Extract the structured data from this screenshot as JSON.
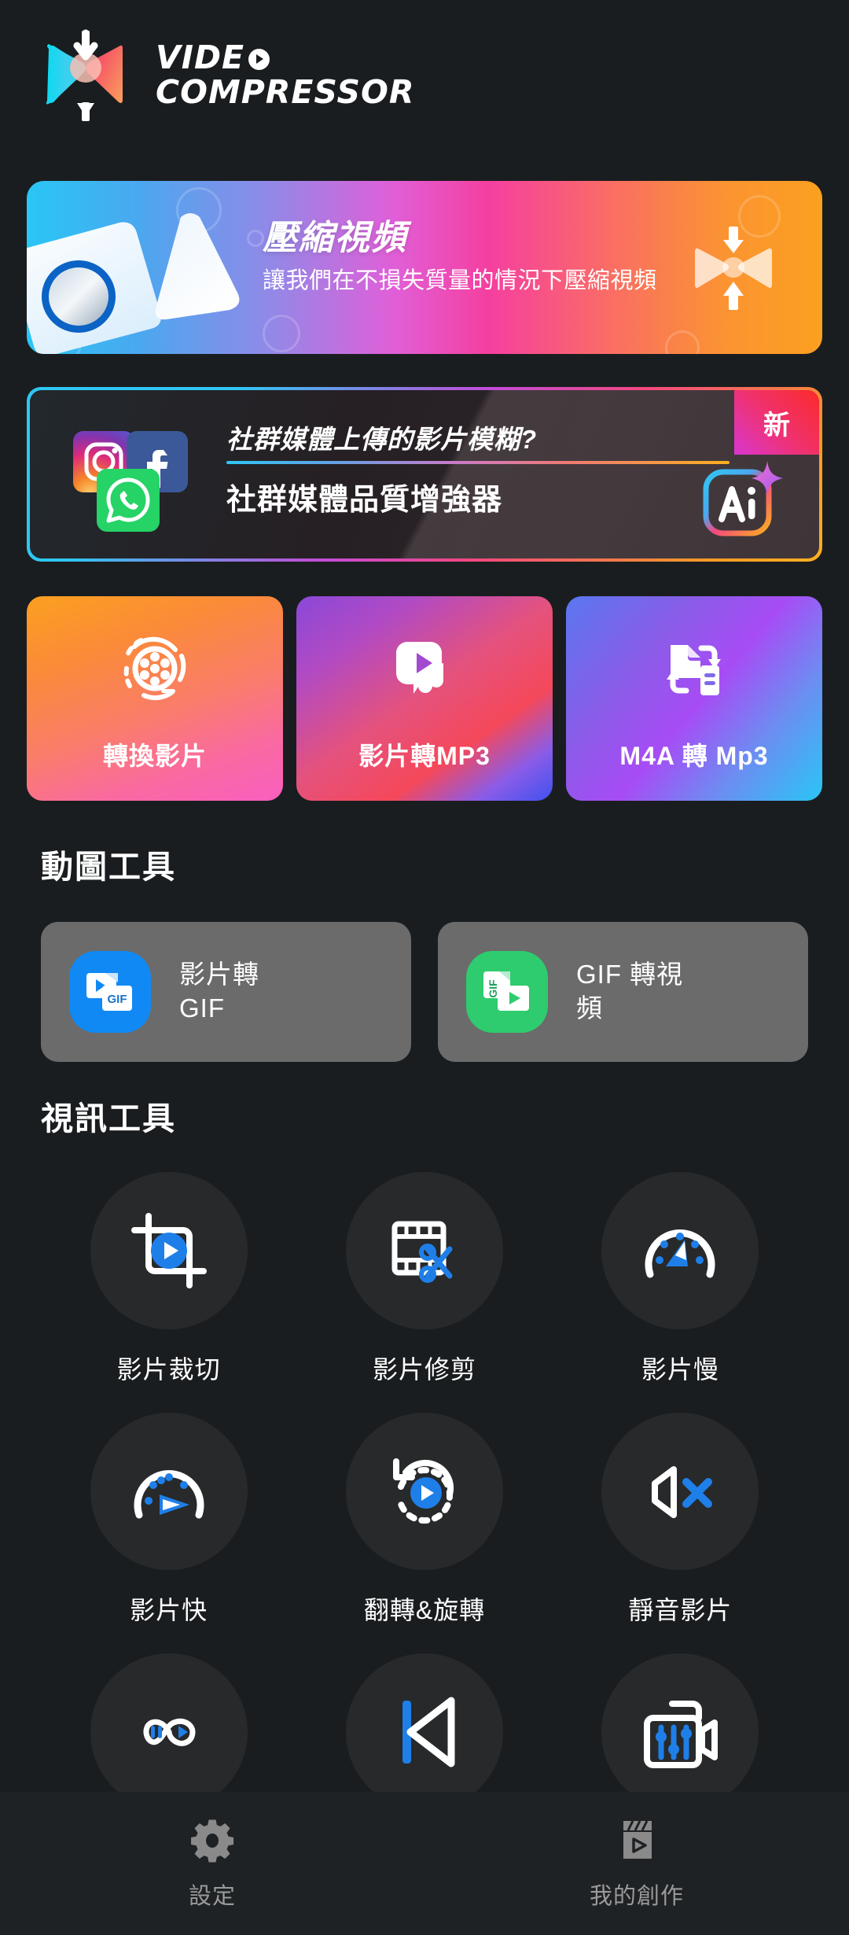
{
  "app": {
    "logo_line1": "VIDE",
    "logo_line2": "COMPRESSOR",
    "logo_icon": "bowtie-compress-logo"
  },
  "compress_banner": {
    "title": "壓縮視頻",
    "subtitle": "讓我們在不損失質量的情況下壓縮視頻",
    "icon": "compress-bowtie-icon",
    "gradient_start": "#29c6f5",
    "gradient_mid": "#f53fa0",
    "gradient_end": "#fba01f"
  },
  "ai_banner": {
    "question": "社群媒體上傳的影片模糊?",
    "headline": "社群媒體品質增強器",
    "badge": "新",
    "ai_label": "Ai",
    "social_icons": [
      "instagram-icon",
      "facebook-icon",
      "whatsapp-icon"
    ],
    "border_gradient_start": "#2fc6f2",
    "border_gradient_end": "#fbb01f",
    "badge_gradient_start": "#d936d0",
    "badge_gradient_end": "#fb2a2a"
  },
  "top_cards": [
    {
      "label": "轉換影片",
      "icon": "film-reel-icon",
      "grad_a": "#f95fc0",
      "grad_b": "#fba01f"
    },
    {
      "label": "影片轉MP3",
      "icon": "video-to-music-icon",
      "grad_a": "#3f51ef",
      "grad_b": "#f5485a"
    },
    {
      "label": "M4A 轉 Mp3",
      "icon": "file-swap-icon",
      "grad_a": "#a74cf5",
      "grad_b": "#29c6f5"
    }
  ],
  "gif_section": {
    "title": "動圖工具",
    "tiles": [
      {
        "label": "影片轉\nGIF",
        "label_l1": "影片轉",
        "label_l2": "GIF",
        "icon": "video-to-gif-icon",
        "color": "#1089f5"
      },
      {
        "label": "GIF 轉視頻",
        "label_l1": "GIF 轉視",
        "label_l2": "頻",
        "icon": "gif-to-video-icon",
        "color": "#2ecc6e"
      }
    ]
  },
  "video_section": {
    "title": "視訊工具",
    "tools": [
      {
        "label": "影片裁切",
        "icon": "crop-video-icon"
      },
      {
        "label": "影片修剪",
        "icon": "trim-scissors-icon"
      },
      {
        "label": "影片慢",
        "icon": "slow-speed-icon"
      },
      {
        "label": "影片快",
        "icon": "fast-speed-icon"
      },
      {
        "label": "翻轉&旋轉",
        "icon": "flip-rotate-icon"
      },
      {
        "label": "靜音影片",
        "icon": "mute-video-icon"
      },
      {
        "label": "",
        "icon": "loop-video-icon"
      },
      {
        "label": "",
        "icon": "reverse-video-icon"
      },
      {
        "label": "",
        "icon": "video-adjust-icon"
      }
    ]
  },
  "bottom_nav": [
    {
      "label": "設定",
      "icon": "gear-icon"
    },
    {
      "label": "我的創作",
      "icon": "clapperboard-icon"
    }
  ],
  "colors": {
    "background": "#1a1d1f",
    "nav_background": "#1e2225",
    "accent_blue": "#1f7fe8",
    "tile_gray": "#6b6b6b",
    "circle_gray": "#27292b"
  }
}
